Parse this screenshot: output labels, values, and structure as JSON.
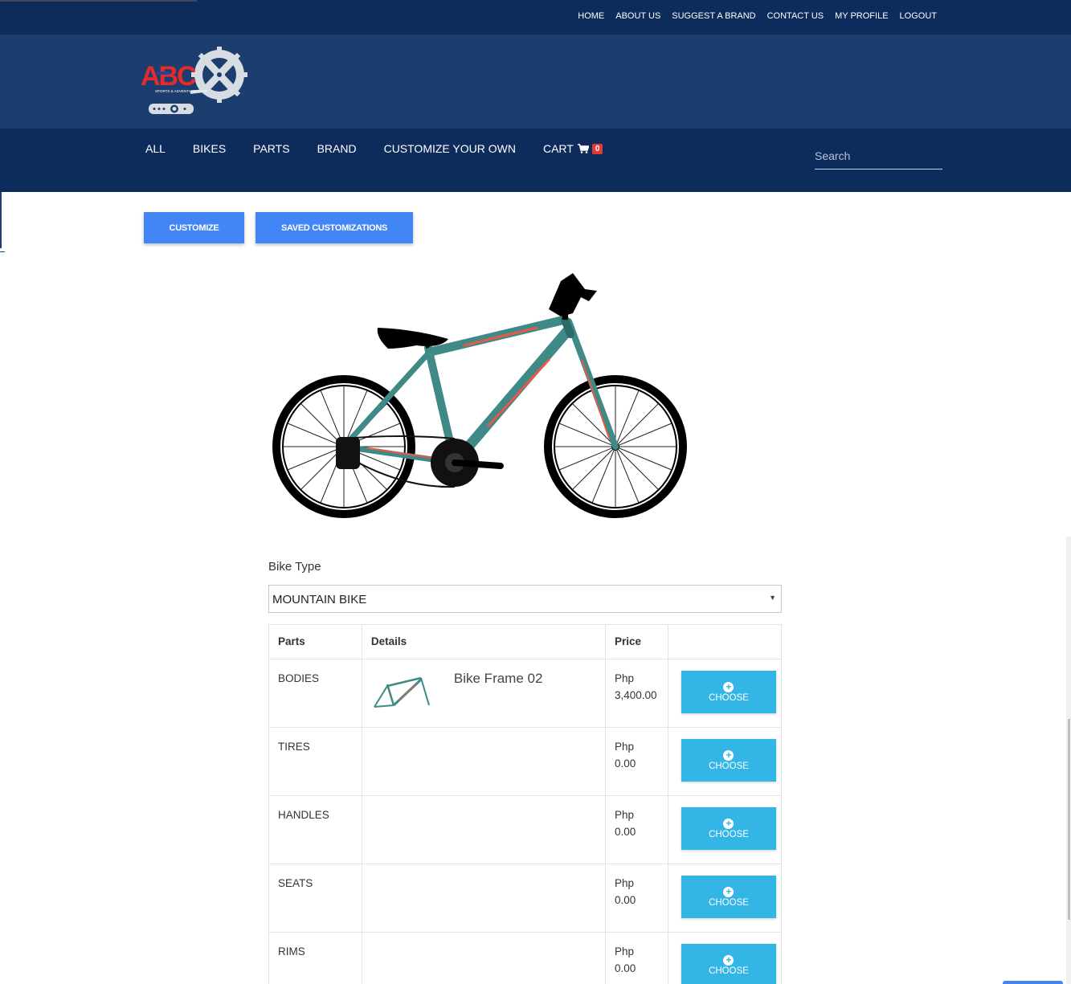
{
  "top_links": [
    "HOME",
    "ABOUT US",
    "SUGGEST A BRAND",
    "CONTACT US",
    "MY PROFILE",
    "LOGOUT"
  ],
  "logo": {
    "text": "ABC",
    "tagline": "SPORTS & ADVENTURE SHOP"
  },
  "nav": {
    "items": [
      "ALL",
      "BIKES",
      "PARTS",
      "BRAND",
      "CUSTOMIZE YOUR OWN"
    ],
    "cart_label": "CART",
    "cart_count": "0",
    "search_placeholder": "Search"
  },
  "actions": {
    "customize": "CUSTOMIZE",
    "saved": "SAVED CUSTOMIZATIONS"
  },
  "bike_type": {
    "label": "Bike Type",
    "selected": "MOUNTAIN BIKE"
  },
  "table": {
    "headers": [
      "Parts",
      "Details",
      "Price",
      ""
    ],
    "rows": [
      {
        "part": "BODIES",
        "detail": "Bike Frame 02",
        "currency": "Php",
        "price": "3,400.00",
        "action": "CHOOSE"
      },
      {
        "part": "TIRES",
        "detail": "",
        "currency": "Php",
        "price": "0.00",
        "action": "CHOOSE"
      },
      {
        "part": "HANDLES",
        "detail": "",
        "currency": "Php",
        "price": "0.00",
        "action": "CHOOSE"
      },
      {
        "part": "SEATS",
        "detail": "",
        "currency": "Php",
        "price": "0.00",
        "action": "CHOOSE"
      },
      {
        "part": "RIMS",
        "detail": "",
        "currency": "Php",
        "price": "0.00",
        "action": "CHOOSE"
      }
    ]
  },
  "colors": {
    "top_bar": "#0d2c5c",
    "brand_bar": "#1c3e6e",
    "primary_button": "#4285f4",
    "choose_button": "#33b5e5",
    "badge": "#e53935",
    "frame_teal": "#3f8a86",
    "frame_accent": "#e8584a"
  },
  "icons": {
    "cart": "shopping-cart-icon",
    "choose": "plus-circle-icon",
    "select": "caret-down-icon"
  }
}
